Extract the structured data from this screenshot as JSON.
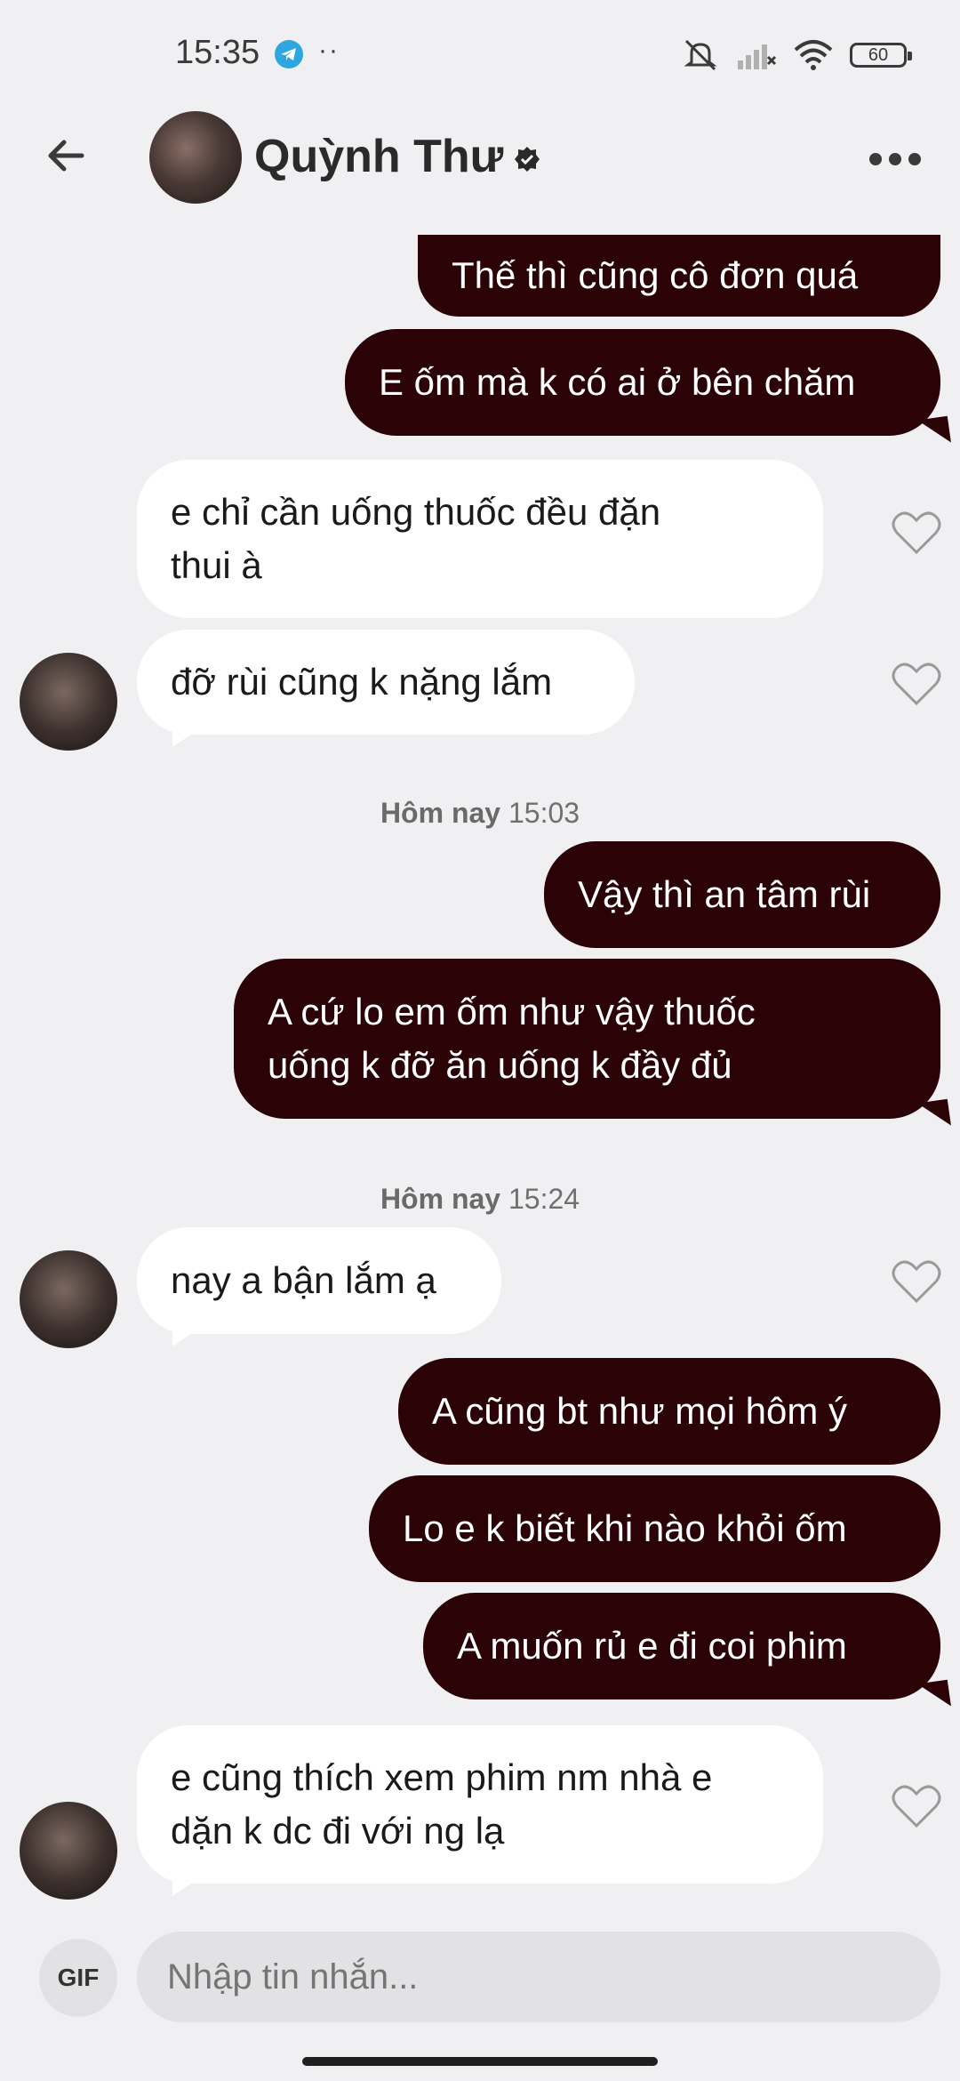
{
  "status_bar": {
    "time": "15:35",
    "dots": "··",
    "battery": "60"
  },
  "header": {
    "contact_name": "Quỳnh Thư"
  },
  "messages": [
    {
      "side": "sent",
      "text": "Thế thì cũng cô đơn quá"
    },
    {
      "side": "sent",
      "text": "E ốm mà k có ai ở bên chăm"
    },
    {
      "side": "received",
      "text": "e chỉ cần uống thuốc đều đặn\nthui à"
    },
    {
      "side": "received",
      "text": "đỡ rùi cũng k nặng lắm"
    },
    {
      "side": "sent",
      "text": "Vậy thì an tâm rùi"
    },
    {
      "side": "sent",
      "text": "A cứ lo em ốm như vậy thuốc\nuống k đỡ ăn uống k đầy đủ"
    },
    {
      "side": "received",
      "text": "nay a bận lắm ạ"
    },
    {
      "side": "sent",
      "text": "A cũng bt như mọi hôm ý"
    },
    {
      "side": "sent",
      "text": "Lo e k biết khi nào khỏi ốm"
    },
    {
      "side": "sent",
      "text": "A muốn rủ e đi coi phim"
    },
    {
      "side": "received",
      "text": "e cũng thích xem phim nm nhà e\ndặn k dc đi với ng lạ"
    }
  ],
  "timestamps": [
    {
      "day": "Hôm nay",
      "time": "15:03"
    },
    {
      "day": "Hôm nay",
      "time": "15:24"
    }
  ],
  "composer": {
    "gif_label": "GIF",
    "placeholder": "Nhập tin nhắn..."
  },
  "colors": {
    "sent_bubble": "#2b0206",
    "received_bubble": "#ffffff",
    "background": "#f0eff1"
  }
}
